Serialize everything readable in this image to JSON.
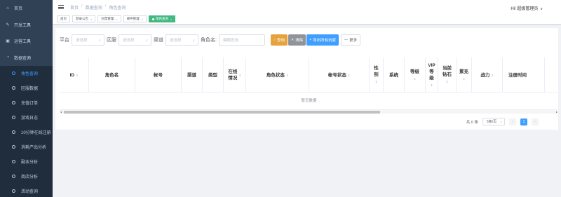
{
  "sidebar": {
    "items": [
      {
        "label": "首页",
        "icon": "home-icon"
      },
      {
        "label": "开发工具",
        "icon": "tool-icon"
      },
      {
        "label": "运营工具",
        "icon": "briefcase-icon"
      },
      {
        "label": "数据查询",
        "icon": "chart-icon"
      }
    ],
    "sub_items": [
      {
        "label": "角色查询"
      },
      {
        "label": "区服数据"
      },
      {
        "label": "充值订单"
      },
      {
        "label": "游戏日志"
      },
      {
        "label": "10分钟在线注册"
      },
      {
        "label": "消耗产出分析"
      },
      {
        "label": "副本分析"
      },
      {
        "label": "商店分析"
      },
      {
        "label": "活动查询"
      }
    ]
  },
  "header": {
    "breadcrumb": [
      "首页",
      "数据查询",
      "角色查询"
    ],
    "user": "Hi! 超级管理员"
  },
  "tags": [
    {
      "label": "首页",
      "closable": false
    },
    {
      "label": "登录公告",
      "closable": true
    },
    {
      "label": "封禁管理",
      "closable": true
    },
    {
      "label": "邮件管理",
      "closable": true
    },
    {
      "label": "角色查询",
      "closable": true,
      "active": true
    }
  ],
  "filters": {
    "platform_label": "平台",
    "platform_placeholder": "请选择",
    "server_label": "区服",
    "server_placeholder": "请选择",
    "channel_label": "渠道",
    "channel_placeholder": "请选择",
    "role_label": "角色名:",
    "role_placeholder": "模糊查询",
    "query_button": "查询",
    "clear_button": "清除",
    "export_button": "导出所有玩家",
    "more_button": "更多"
  },
  "table": {
    "columns": [
      "ID",
      "角色名",
      "帐号",
      "渠道",
      "类型",
      "在线情况",
      "角色状态",
      "帐号状态",
      "性别",
      "系统",
      "等级",
      "VIP等级",
      "当前钻石",
      "累充",
      "战力",
      "注册时间"
    ],
    "empty_text": "暂无数据"
  },
  "pagination": {
    "total": "共 0 条",
    "page_size": "5条/页",
    "current_page": "1"
  },
  "colors": {
    "sidebar_bg": "#304156",
    "accent": "#409eff",
    "active_tag": "#42b983",
    "query_btn": "#e6a23c",
    "clear_btn": "#909399"
  }
}
